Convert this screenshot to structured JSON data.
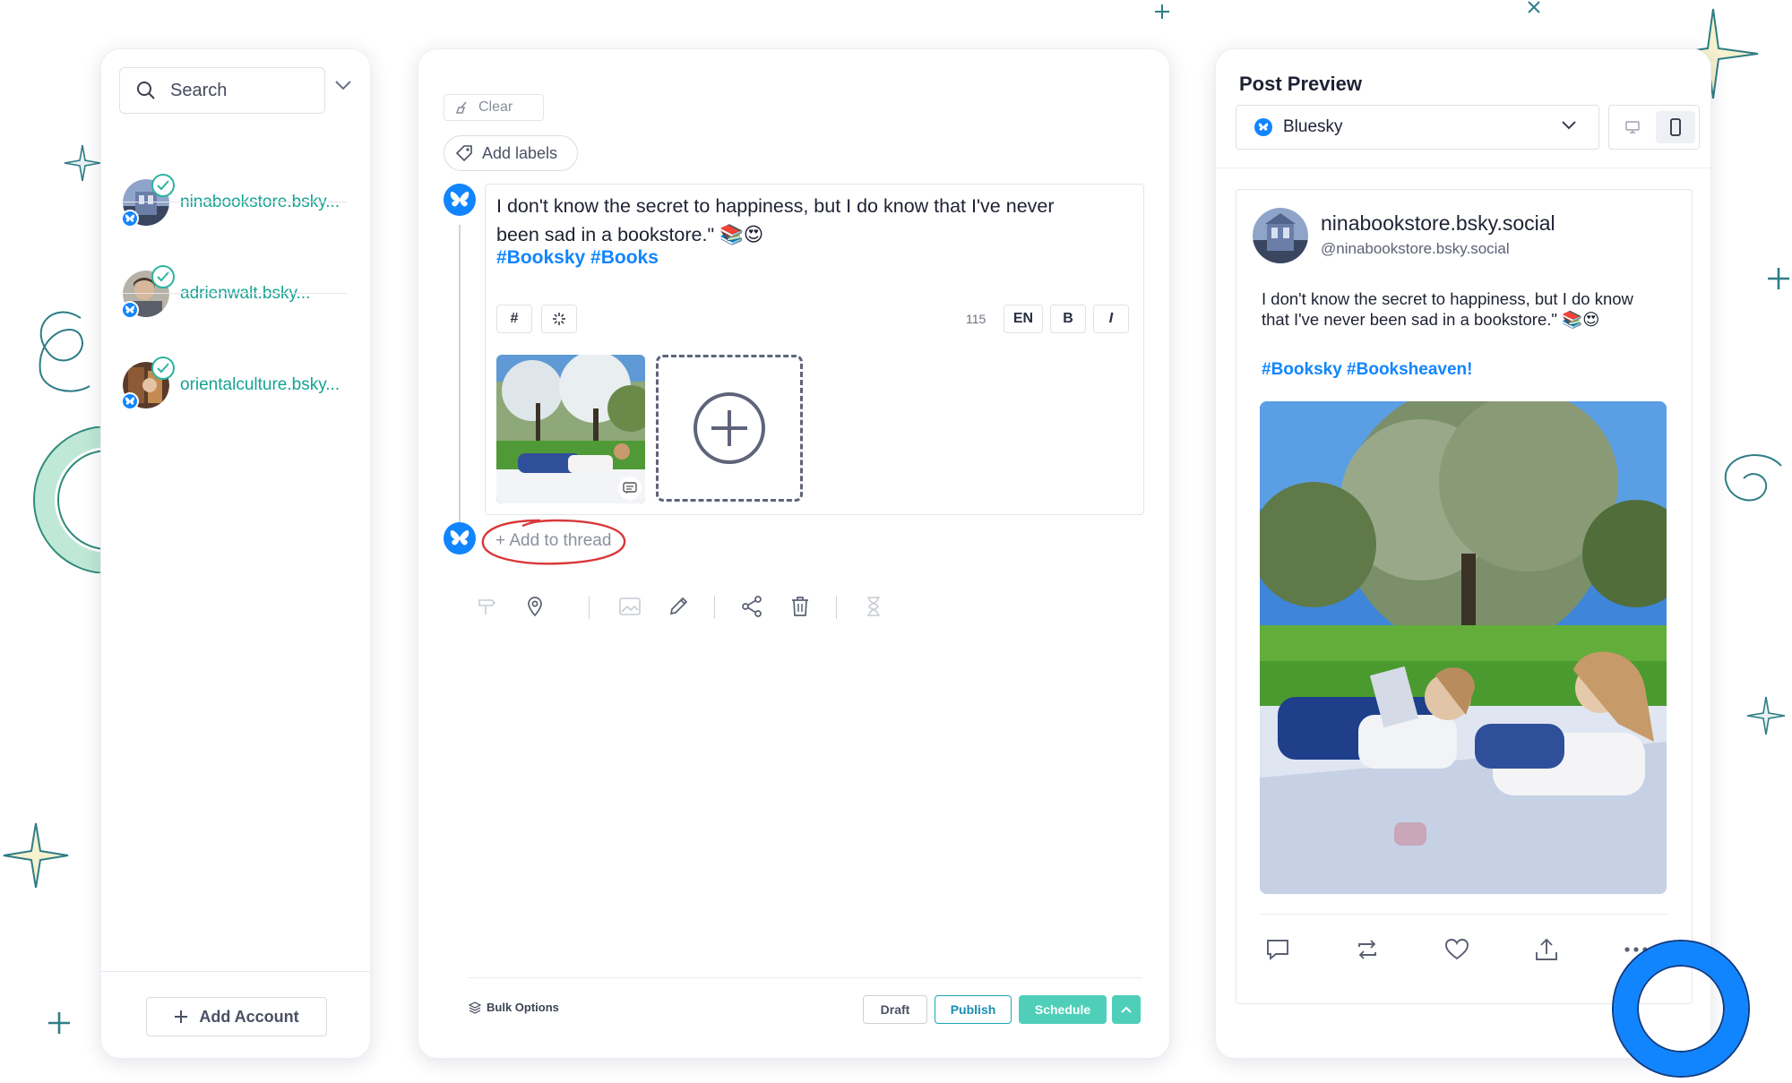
{
  "accounts_panel": {
    "search": {
      "label": "Search"
    },
    "accounts": [
      {
        "name": "ninabookstore.bsky..."
      },
      {
        "name": "adrienwalt.bsky..."
      },
      {
        "name": "orientalculture.bsky..."
      }
    ],
    "add_account_label": "Add Account"
  },
  "editor": {
    "clear_label": "Clear",
    "add_labels_label": "Add labels",
    "post_text": "I don't know the secret to happiness, but I do know that I've never been sad in a bookstore.\" 📚😍",
    "hashtags": "#Booksky #Books",
    "toolbar": {
      "hashtag": "#",
      "char_count": "115",
      "language": "EN",
      "bold": "B",
      "italic": "I"
    },
    "add_to_thread_label": "+ Add to thread",
    "footer": {
      "bulk_options_label": "Bulk Options",
      "draft_label": "Draft",
      "publish_label": "Publish",
      "schedule_label": "Schedule"
    }
  },
  "preview": {
    "title": "Post Preview",
    "network": "Bluesky",
    "post": {
      "display_name": "ninabookstore.bsky.social",
      "handle": "@ninabookstore.bsky.social",
      "text": "I don't know the secret to happiness, but I do know that I've never been sad in a bookstore.\" 📚😍",
      "hashtags": "#Booksky #Booksheaven!"
    }
  },
  "colors": {
    "accent_teal": "#4fcfb9",
    "bluesky_blue": "#1185fe",
    "account_name": "#14a394",
    "annotation_red": "#d9383a"
  }
}
